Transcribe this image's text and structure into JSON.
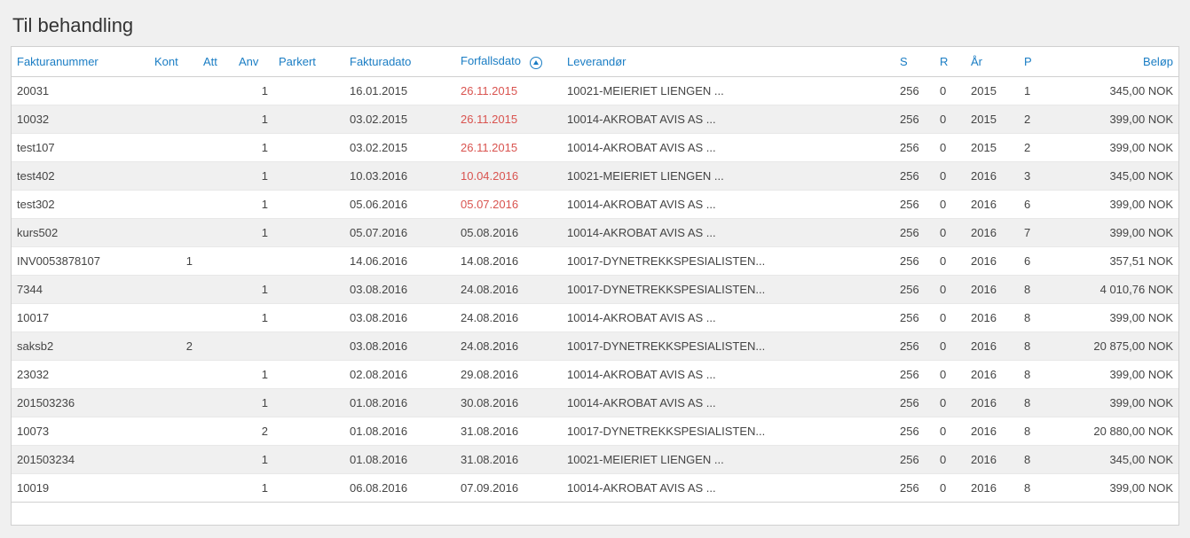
{
  "title": "Til behandling",
  "columns": {
    "fakturanummer": "Fakturanummer",
    "kont": "Kont",
    "att": "Att",
    "anv": "Anv",
    "parkert": "Parkert",
    "fakturadato": "Fakturadato",
    "forfallsdato": "Forfallsdato",
    "leverandor": "Leverandør",
    "s": "S",
    "r": "R",
    "ar": "År",
    "p": "P",
    "belop": "Beløp"
  },
  "rows": [
    {
      "fakturanummer": "20031",
      "kont": "",
      "att": "",
      "anv": "1",
      "parkert": "",
      "fakturadato": "16.01.2015",
      "forfallsdato": "26.11.2015",
      "overdue": true,
      "leverandor": "10021-MEIERIET LIENGEN ...",
      "s": "256",
      "r": "0",
      "ar": "2015",
      "p": "1",
      "belop": "345,00 NOK"
    },
    {
      "fakturanummer": "10032",
      "kont": "",
      "att": "",
      "anv": "1",
      "parkert": "",
      "fakturadato": "03.02.2015",
      "forfallsdato": "26.11.2015",
      "overdue": true,
      "leverandor": "10014-AKROBAT AVIS AS ...",
      "s": "256",
      "r": "0",
      "ar": "2015",
      "p": "2",
      "belop": "399,00 NOK"
    },
    {
      "fakturanummer": "test107",
      "kont": "",
      "att": "",
      "anv": "1",
      "parkert": "",
      "fakturadato": "03.02.2015",
      "forfallsdato": "26.11.2015",
      "overdue": true,
      "leverandor": "10014-AKROBAT AVIS AS ...",
      "s": "256",
      "r": "0",
      "ar": "2015",
      "p": "2",
      "belop": "399,00 NOK"
    },
    {
      "fakturanummer": "test402",
      "kont": "",
      "att": "",
      "anv": "1",
      "parkert": "",
      "fakturadato": "10.03.2016",
      "forfallsdato": "10.04.2016",
      "overdue": true,
      "leverandor": "10021-MEIERIET LIENGEN ...",
      "s": "256",
      "r": "0",
      "ar": "2016",
      "p": "3",
      "belop": "345,00 NOK"
    },
    {
      "fakturanummer": "test302",
      "kont": "",
      "att": "",
      "anv": "1",
      "parkert": "",
      "fakturadato": "05.06.2016",
      "forfallsdato": "05.07.2016",
      "overdue": true,
      "leverandor": "10014-AKROBAT AVIS AS ...",
      "s": "256",
      "r": "0",
      "ar": "2016",
      "p": "6",
      "belop": "399,00 NOK"
    },
    {
      "fakturanummer": "kurs502",
      "kont": "",
      "att": "",
      "anv": "1",
      "parkert": "",
      "fakturadato": "05.07.2016",
      "forfallsdato": "05.08.2016",
      "overdue": false,
      "leverandor": "10014-AKROBAT AVIS AS ...",
      "s": "256",
      "r": "0",
      "ar": "2016",
      "p": "7",
      "belop": "399,00 NOK"
    },
    {
      "fakturanummer": "INV0053878107",
      "kont": "1",
      "att": "",
      "anv": "",
      "parkert": "",
      "fakturadato": "14.06.2016",
      "forfallsdato": "14.08.2016",
      "overdue": false,
      "leverandor": "10017-DYNETREKKSPESIALISTEN...",
      "s": "256",
      "r": "0",
      "ar": "2016",
      "p": "6",
      "belop": "357,51 NOK"
    },
    {
      "fakturanummer": "7344",
      "kont": "",
      "att": "",
      "anv": "1",
      "parkert": "",
      "fakturadato": "03.08.2016",
      "forfallsdato": "24.08.2016",
      "overdue": false,
      "leverandor": "10017-DYNETREKKSPESIALISTEN...",
      "s": "256",
      "r": "0",
      "ar": "2016",
      "p": "8",
      "belop": "4 010,76 NOK"
    },
    {
      "fakturanummer": "10017",
      "kont": "",
      "att": "",
      "anv": "1",
      "parkert": "",
      "fakturadato": "03.08.2016",
      "forfallsdato": "24.08.2016",
      "overdue": false,
      "leverandor": "10014-AKROBAT AVIS AS ...",
      "s": "256",
      "r": "0",
      "ar": "2016",
      "p": "8",
      "belop": "399,00 NOK"
    },
    {
      "fakturanummer": "saksb2",
      "kont": "2",
      "att": "",
      "anv": "",
      "parkert": "",
      "fakturadato": "03.08.2016",
      "forfallsdato": "24.08.2016",
      "overdue": false,
      "leverandor": "10017-DYNETREKKSPESIALISTEN...",
      "s": "256",
      "r": "0",
      "ar": "2016",
      "p": "8",
      "belop": "20 875,00 NOK"
    },
    {
      "fakturanummer": "23032",
      "kont": "",
      "att": "",
      "anv": "1",
      "parkert": "",
      "fakturadato": "02.08.2016",
      "forfallsdato": "29.08.2016",
      "overdue": false,
      "leverandor": "10014-AKROBAT AVIS AS ...",
      "s": "256",
      "r": "0",
      "ar": "2016",
      "p": "8",
      "belop": "399,00 NOK"
    },
    {
      "fakturanummer": "201503236",
      "kont": "",
      "att": "",
      "anv": "1",
      "parkert": "",
      "fakturadato": "01.08.2016",
      "forfallsdato": "30.08.2016",
      "overdue": false,
      "leverandor": "10014-AKROBAT AVIS AS ...",
      "s": "256",
      "r": "0",
      "ar": "2016",
      "p": "8",
      "belop": "399,00 NOK"
    },
    {
      "fakturanummer": "10073",
      "kont": "",
      "att": "",
      "anv": "2",
      "parkert": "",
      "fakturadato": "01.08.2016",
      "forfallsdato": "31.08.2016",
      "overdue": false,
      "leverandor": "10017-DYNETREKKSPESIALISTEN...",
      "s": "256",
      "r": "0",
      "ar": "2016",
      "p": "8",
      "belop": "20 880,00 NOK"
    },
    {
      "fakturanummer": "201503234",
      "kont": "",
      "att": "",
      "anv": "1",
      "parkert": "",
      "fakturadato": "01.08.2016",
      "forfallsdato": "31.08.2016",
      "overdue": false,
      "leverandor": "10021-MEIERIET LIENGEN ...",
      "s": "256",
      "r": "0",
      "ar": "2016",
      "p": "8",
      "belop": "345,00 NOK"
    },
    {
      "fakturanummer": "10019",
      "kont": "",
      "att": "",
      "anv": "1",
      "parkert": "",
      "fakturadato": "06.08.2016",
      "forfallsdato": "07.09.2016",
      "overdue": false,
      "leverandor": "10014-AKROBAT AVIS AS ...",
      "s": "256",
      "r": "0",
      "ar": "2016",
      "p": "8",
      "belop": "399,00 NOK"
    }
  ]
}
